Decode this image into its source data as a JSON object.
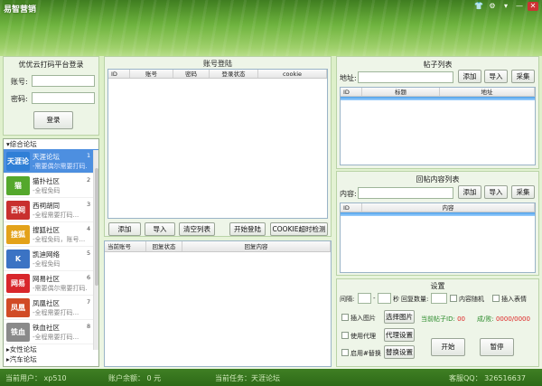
{
  "window": {
    "title": "易智营销"
  },
  "login": {
    "title": "优优云打码平台登录",
    "account_label": "账号:",
    "password_label": "密码:",
    "account_value": "",
    "password_value": "",
    "login_button": "登录"
  },
  "forums": {
    "category_open": "▾综合论坛",
    "items": [
      {
        "name": "天涯论坛",
        "desc": "-需要偶尔需要打码...",
        "index": "1",
        "logo_text": "天涯论坛",
        "color": "#2f7fd6"
      },
      {
        "name": "猫扑社区",
        "desc": "-全程免码",
        "index": "2",
        "logo_text": "猫",
        "color": "#54a82c"
      },
      {
        "name": "西祠胡同",
        "desc": "-全程需要打码...",
        "index": "3",
        "logo_text": "西祠",
        "color": "#c8302e"
      },
      {
        "name": "搜狐社区",
        "desc": "-全程免码，账号...",
        "index": "4",
        "logo_text": "搜狐",
        "color": "#e3a21a"
      },
      {
        "name": "凯迪网络",
        "desc": "-全程免码",
        "index": "5",
        "logo_text": "K",
        "color": "#3b73c4"
      },
      {
        "name": "网易社区",
        "desc": "-需要偶尔需要打码...",
        "index": "6",
        "logo_text": "网易",
        "color": "#d8262b"
      },
      {
        "name": "凤凰社区",
        "desc": "-全程需要打码...",
        "index": "7",
        "logo_text": "凤凰",
        "color": "#d14b26"
      },
      {
        "name": "铁血社区",
        "desc": "-全程需要打码...",
        "index": "8",
        "logo_text": "铁血",
        "color": "#8a8a8a"
      }
    ],
    "category_female": "▸女性论坛",
    "category_more": "▸汽车论坛"
  },
  "accounts": {
    "title": "账号登陆",
    "columns": [
      "ID",
      "账号",
      "密码",
      "登录状态",
      "cookie"
    ],
    "buttons": {
      "add": "添加",
      "import": "导入",
      "clear": "清空列表",
      "start_login": "开始登陆",
      "cookie_check": "COOKIE超时检测"
    }
  },
  "reply_log": {
    "columns": [
      "当前账号",
      "回复状态",
      "回复内容"
    ]
  },
  "posts": {
    "title": "帖子列表",
    "address_label": "地址:",
    "address_value": "",
    "columns": [
      "ID",
      "标题",
      "地址"
    ],
    "add": "添加",
    "import": "导入",
    "collect": "采集"
  },
  "reply_content": {
    "title": "回帖内容列表",
    "content_label": "内容:",
    "content_value": "",
    "columns": [
      "ID",
      "内容"
    ],
    "add": "添加",
    "import": "导入",
    "collect": "采集"
  },
  "settings": {
    "title": "设置",
    "interval_label": "间隔:",
    "interval_min": "",
    "interval_sep": "-",
    "interval_max": "",
    "seconds_label": "秒",
    "reply_count_label": "回复数量:",
    "reply_count_value": "",
    "random_content_label": "内容随机",
    "insert_emoji_label": "插入表情",
    "insert_image_label": "插入图片",
    "choose_image_button": "选择图片",
    "post_id_label": "当前帖子ID:",
    "post_id_value": "00",
    "success_fail_label": "成/败:",
    "success_fail_value": "0000/0000",
    "use_proxy_label": "使用代理",
    "proxy_settings_button": "代理设置",
    "enable_replace_label": "启用#替换",
    "replace_settings_button": "替换设置",
    "start_button": "开始",
    "pause_button": "暂停"
  },
  "status": {
    "current_user": "当前用户： xp510",
    "balance": "账户余额：  0 元",
    "current_task": "当前任务：天涯论坛",
    "qq": "客服QQ： 326516637"
  }
}
